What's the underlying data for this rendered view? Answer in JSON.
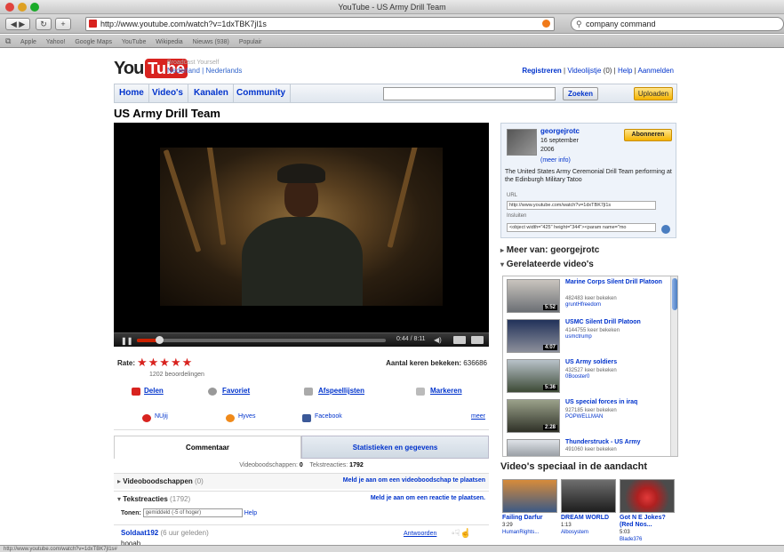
{
  "browser": {
    "title": "YouTube - US Army Drill Team",
    "url": "http://www.youtube.com/watch?v=1dxTBK7jl1s",
    "search_value": "company command",
    "bookmarks": [
      "Apple",
      "Yahoo!",
      "Google Maps",
      "YouTube",
      "Wikipedia",
      "Nieuws (938)",
      "Populair"
    ],
    "status_text": "http://www.youtube.com/watch?v=1dxTBK7jl1s#"
  },
  "header": {
    "logo_you": "You",
    "logo_tube": "Tube",
    "tagline": "Broadcast Yourself",
    "locale": "Nederland",
    "locale_sep": "|",
    "locale_link": "Nederlands",
    "links": {
      "register": "Registreren",
      "playlist": "Videolijstje",
      "playlist_count": "(0)",
      "help": "Help",
      "login": "Aanmelden"
    }
  },
  "nav": {
    "tabs": [
      "Home",
      "Video's",
      "Kanalen",
      "Community"
    ],
    "search_button": "Zoeken",
    "upload_button": "Uploaden"
  },
  "video": {
    "title": "US Army Drill Team",
    "time": "0:44 / 8:11",
    "progress_fraction": 0.09,
    "rate_label": "Rate:",
    "stars": "★★★★★",
    "ratings_count": "1202 beoordelingen",
    "views_label": "Aantal keren bekeken:",
    "views_value": "636686",
    "actions": [
      "Delen",
      "Favoriet",
      "Afspeellijsten",
      "Markeren"
    ],
    "social": [
      "NUjij",
      "Hyves",
      "Facebook"
    ],
    "more_link": "meer"
  },
  "comments": {
    "tab_active": "Commentaar",
    "tab_inactive": "Statistieken en gegevens",
    "counts_label_a": "Videoboodschappen:",
    "counts_value_a": "0",
    "counts_label_b": "Tekstreacties:",
    "counts_value_b": "1792",
    "video_responses_label": "Videoboodschappen",
    "video_responses_count": "(0)",
    "video_responses_action": "Meld je aan om een videoboodschap te plaatsen",
    "text_responses_label": "Tekstreacties",
    "text_responses_count": "(1792)",
    "text_responses_action": "Meld je aan om een reactie te plaatsen.",
    "show_label": "Tonen:",
    "show_value": "gemiddeld (-5 of hoger)",
    "show_help": "Help",
    "first": {
      "user": "Soldaat192",
      "age": "(6 uur geleden)",
      "reply": "Antwoorden",
      "body": "hooah"
    }
  },
  "uploader": {
    "name": "georgejrotc",
    "date_line1": "16 september",
    "date_line2": "2006",
    "more": "(meer info)",
    "subscribe": "Abonneren",
    "description": "The United States Army Ceremonial Drill Team performing at the Edinburgh Military Tatoo",
    "url_label": "URL",
    "url_value": "http://www.youtube.com/watch?v=1dxTBK7jl1s",
    "embed_label": "Insluiten",
    "embed_value": "<object width=\"425\" height=\"344\"><param name=\"mo"
  },
  "sidebar": {
    "more_from": "Meer van: georgejrotc",
    "related_head": "Gerelateerde video's",
    "related": [
      {
        "title": "Marine Corps Silent Drill Platoon",
        "views": "482483 keer bekeken",
        "user": "gruntHfreedom",
        "duration": "5:52"
      },
      {
        "title": "USMC Silent Drill Platoon",
        "views": "4144755 keer bekeken",
        "user": "usmctrump",
        "duration": "4:07"
      },
      {
        "title": "US Army soldiers",
        "views": "432527 keer bekeken",
        "user": "0Booster0",
        "duration": "5:36"
      },
      {
        "title": "US special forces in iraq",
        "views": "927185 keer bekeken",
        "user": "POPWELLMAN",
        "duration": "2:28"
      },
      {
        "title": "Thunderstruck - US Army",
        "views": "491060 keer bekeken",
        "user": "",
        "duration": ""
      }
    ],
    "featured_head": "Video's speciaal in de aandacht",
    "featured": [
      {
        "title": "Failing Darfur",
        "duration": "3:29",
        "user": "HumanRights..."
      },
      {
        "title": "DREAM WORLD",
        "duration": "1:13",
        "user": "Albosystem"
      },
      {
        "title": "Got N E Jokes? (Red Nos...",
        "duration": "5:03",
        "user": "Blade376"
      }
    ]
  },
  "colors": {
    "brand_red": "#d8231f",
    "link_blue": "#0033cc",
    "upload_yellow": "#f5b400"
  }
}
